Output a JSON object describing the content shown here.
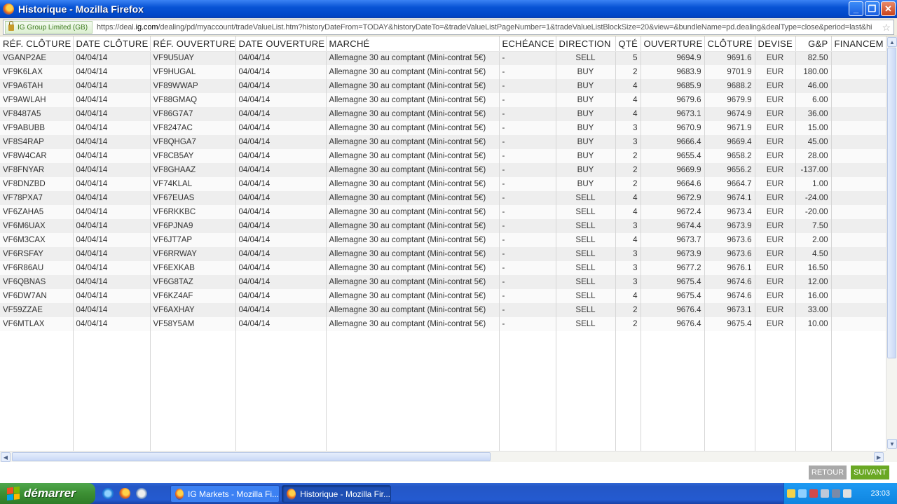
{
  "window": {
    "title": "Historique - Mozilla Firefox"
  },
  "address_bar": {
    "identity": "IG Group Limited (GB)",
    "url_prefix": "https://deal.",
    "url_host": "ig.com",
    "url_rest": "/dealing/pd/myaccount/tradeValueList.htm?historyDateFrom=TODAY&historyDateTo=&tradeValueListPageNumber=1&tradeValueListBlockSize=20&view=&bundleName=pd.dealing&dealType=close&period=last&hi"
  },
  "table": {
    "headers": [
      "RÉF. CLÔTURE",
      "DATE CLÔTURE",
      "RÉF. OUVERTURE",
      "DATE OUVERTURE",
      "MARCHÉ",
      "ECHÉANCE",
      "DIRECTION",
      "QTÉ",
      "OUVERTURE",
      "CLÔTURE",
      "DEVISE",
      "G&P",
      "FINANCEM"
    ],
    "rows": [
      [
        "VGANP2AE",
        "04/04/14",
        "VF9U5UAY",
        "04/04/14",
        "Allemagne 30 au comptant (Mini-contrat 5€)",
        "-",
        "SELL",
        "5",
        "9694.9",
        "9691.6",
        "EUR",
        "82.50",
        ""
      ],
      [
        "VF9K6LAX",
        "04/04/14",
        "VF9HUGAL",
        "04/04/14",
        "Allemagne 30 au comptant (Mini-contrat 5€)",
        "-",
        "BUY",
        "2",
        "9683.9",
        "9701.9",
        "EUR",
        "180.00",
        ""
      ],
      [
        "VF9A6TAH",
        "04/04/14",
        "VF89WWAP",
        "04/04/14",
        "Allemagne 30 au comptant (Mini-contrat 5€)",
        "-",
        "BUY",
        "4",
        "9685.9",
        "9688.2",
        "EUR",
        "46.00",
        ""
      ],
      [
        "VF9AWLAH",
        "04/04/14",
        "VF88GMAQ",
        "04/04/14",
        "Allemagne 30 au comptant (Mini-contrat 5€)",
        "-",
        "BUY",
        "4",
        "9679.6",
        "9679.9",
        "EUR",
        "6.00",
        ""
      ],
      [
        "VF8487A5",
        "04/04/14",
        "VF86G7A7",
        "04/04/14",
        "Allemagne 30 au comptant (Mini-contrat 5€)",
        "-",
        "BUY",
        "4",
        "9673.1",
        "9674.9",
        "EUR",
        "36.00",
        ""
      ],
      [
        "VF9ABUBB",
        "04/04/14",
        "VF8247AC",
        "04/04/14",
        "Allemagne 30 au comptant (Mini-contrat 5€)",
        "-",
        "BUY",
        "3",
        "9670.9",
        "9671.9",
        "EUR",
        "15.00",
        ""
      ],
      [
        "VF8S4RAP",
        "04/04/14",
        "VF8QHGA7",
        "04/04/14",
        "Allemagne 30 au comptant (Mini-contrat 5€)",
        "-",
        "BUY",
        "3",
        "9666.4",
        "9669.4",
        "EUR",
        "45.00",
        ""
      ],
      [
        "VF8W4CAR",
        "04/04/14",
        "VF8CB5AY",
        "04/04/14",
        "Allemagne 30 au comptant (Mini-contrat 5€)",
        "-",
        "BUY",
        "2",
        "9655.4",
        "9658.2",
        "EUR",
        "28.00",
        ""
      ],
      [
        "VF8FNYAR",
        "04/04/14",
        "VF8GHAAZ",
        "04/04/14",
        "Allemagne 30 au comptant (Mini-contrat 5€)",
        "-",
        "BUY",
        "2",
        "9669.9",
        "9656.2",
        "EUR",
        "-137.00",
        ""
      ],
      [
        "VF8DNZBD",
        "04/04/14",
        "VF74KLAL",
        "04/04/14",
        "Allemagne 30 au comptant (Mini-contrat 5€)",
        "-",
        "BUY",
        "2",
        "9664.6",
        "9664.7",
        "EUR",
        "1.00",
        ""
      ],
      [
        "VF78PXA7",
        "04/04/14",
        "VF67EUAS",
        "04/04/14",
        "Allemagne 30 au comptant (Mini-contrat 5€)",
        "-",
        "SELL",
        "4",
        "9672.9",
        "9674.1",
        "EUR",
        "-24.00",
        ""
      ],
      [
        "VF6ZAHA5",
        "04/04/14",
        "VF6RKKBC",
        "04/04/14",
        "Allemagne 30 au comptant (Mini-contrat 5€)",
        "-",
        "SELL",
        "4",
        "9672.4",
        "9673.4",
        "EUR",
        "-20.00",
        ""
      ],
      [
        "VF6M6UAX",
        "04/04/14",
        "VF6PJNA9",
        "04/04/14",
        "Allemagne 30 au comptant (Mini-contrat 5€)",
        "-",
        "SELL",
        "3",
        "9674.4",
        "9673.9",
        "EUR",
        "7.50",
        ""
      ],
      [
        "VF6M3CAX",
        "04/04/14",
        "VF6JT7AP",
        "04/04/14",
        "Allemagne 30 au comptant (Mini-contrat 5€)",
        "-",
        "SELL",
        "4",
        "9673.7",
        "9673.6",
        "EUR",
        "2.00",
        ""
      ],
      [
        "VF6RSFAY",
        "04/04/14",
        "VF6RRWAY",
        "04/04/14",
        "Allemagne 30 au comptant (Mini-contrat 5€)",
        "-",
        "SELL",
        "3",
        "9673.9",
        "9673.6",
        "EUR",
        "4.50",
        ""
      ],
      [
        "VF6R86AU",
        "04/04/14",
        "VF6EXKAB",
        "04/04/14",
        "Allemagne 30 au comptant (Mini-contrat 5€)",
        "-",
        "SELL",
        "3",
        "9677.2",
        "9676.1",
        "EUR",
        "16.50",
        ""
      ],
      [
        "VF6QBNAS",
        "04/04/14",
        "VF6G8TAZ",
        "04/04/14",
        "Allemagne 30 au comptant (Mini-contrat 5€)",
        "-",
        "SELL",
        "3",
        "9675.4",
        "9674.6",
        "EUR",
        "12.00",
        ""
      ],
      [
        "VF6DW7AN",
        "04/04/14",
        "VF6KZ4AF",
        "04/04/14",
        "Allemagne 30 au comptant (Mini-contrat 5€)",
        "-",
        "SELL",
        "4",
        "9675.4",
        "9674.6",
        "EUR",
        "16.00",
        ""
      ],
      [
        "VF59ZZAE",
        "04/04/14",
        "VF6AXHAY",
        "04/04/14",
        "Allemagne 30 au comptant (Mini-contrat 5€)",
        "-",
        "SELL",
        "2",
        "9676.4",
        "9673.1",
        "EUR",
        "33.00",
        ""
      ],
      [
        "VF6MTLAX",
        "04/04/14",
        "VF58Y5AM",
        "04/04/14",
        "Allemagne 30 au comptant (Mini-contrat 5€)",
        "-",
        "SELL",
        "2",
        "9676.4",
        "9675.4",
        "EUR",
        "10.00",
        ""
      ]
    ]
  },
  "footer": {
    "back_label": "RETOUR",
    "next_label": "SUIVANT"
  },
  "taskbar": {
    "start_label": "démarrer",
    "tasks": [
      "IG Markets - Mozilla Fi...",
      "Historique - Mozilla Fir..."
    ],
    "clock": "23:03"
  },
  "colors": {
    "titlebar": "#0853d4",
    "next_button": "#6aa824",
    "back_button": "#a9a9a9",
    "start_button": "#3c8f33"
  }
}
